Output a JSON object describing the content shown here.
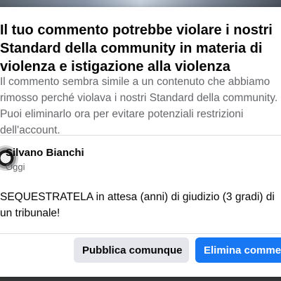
{
  "dialog": {
    "title": "Il tuo commento potrebbe violare i nostri Standard della community in materia di violenza e istigazione alla violenza",
    "description": "Il commento sembra simile a un contenuto che abbiamo rimosso perché violava i nostri Standard della community. Puoi eliminarlo ora per evitare potenziali restrizioni dell'account."
  },
  "comment": {
    "author": "Silvano Bianchi",
    "time": "Oggi",
    "text": "SEQUESTRATELA in attesa (anni) di giudizio (3 gradi) di un tribunale!"
  },
  "buttons": {
    "post_anyway": "Pubblica comunque",
    "delete_comment": "Elimina commento"
  },
  "colors": {
    "primary": "#1877f2",
    "secondary_button": "#e4e6eb",
    "muted_text": "#65676b"
  }
}
